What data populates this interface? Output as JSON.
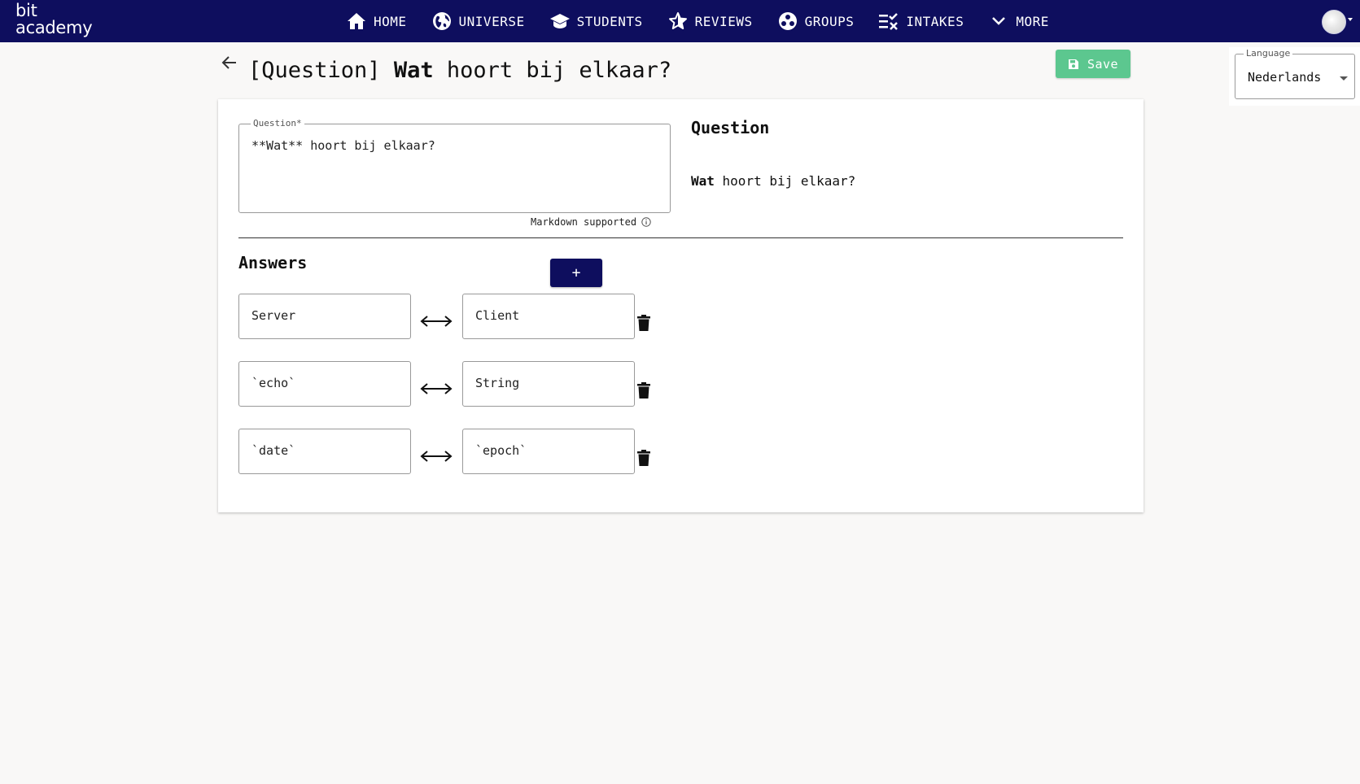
{
  "logo": {
    "line1": "bit",
    "line2": "academy"
  },
  "nav": {
    "items": [
      {
        "label": "HOME",
        "icon": "home-icon"
      },
      {
        "label": "UNIVERSE",
        "icon": "globe-icon"
      },
      {
        "label": "STUDENTS",
        "icon": "graduation-cap-icon"
      },
      {
        "label": "REVIEWS",
        "icon": "star-icon"
      },
      {
        "label": "GROUPS",
        "icon": "groups-icon"
      },
      {
        "label": "INTAKES",
        "icon": "checklist-icon"
      },
      {
        "label": "MORE",
        "icon": "chevron-down-icon"
      }
    ]
  },
  "header": {
    "title_prefix": "[Question] ",
    "title_bold": "Wat",
    "title_rest": " hoort bij elkaar?"
  },
  "toolbar": {
    "save_label": "Save",
    "save_color": "#5cc78f"
  },
  "language": {
    "legend": "Language",
    "value": "Nederlands"
  },
  "question": {
    "legend": "Question*",
    "value": "**Wat** hoort bij elkaar?",
    "markdown_note": "Markdown supported"
  },
  "preview": {
    "heading": "Question",
    "bold": "Wat",
    "rest": " hoort bij elkaar?"
  },
  "answers": {
    "heading": "Answers",
    "add_label": "+",
    "pairs": [
      {
        "left": "Server",
        "right": "Client"
      },
      {
        "left": "`echo`",
        "right": "String"
      },
      {
        "left": "`date`",
        "right": "`epoch`"
      }
    ]
  },
  "colors": {
    "navbar": "#0e0e5e",
    "accent": "#0e0e5e",
    "background": "#f9f8f7"
  }
}
